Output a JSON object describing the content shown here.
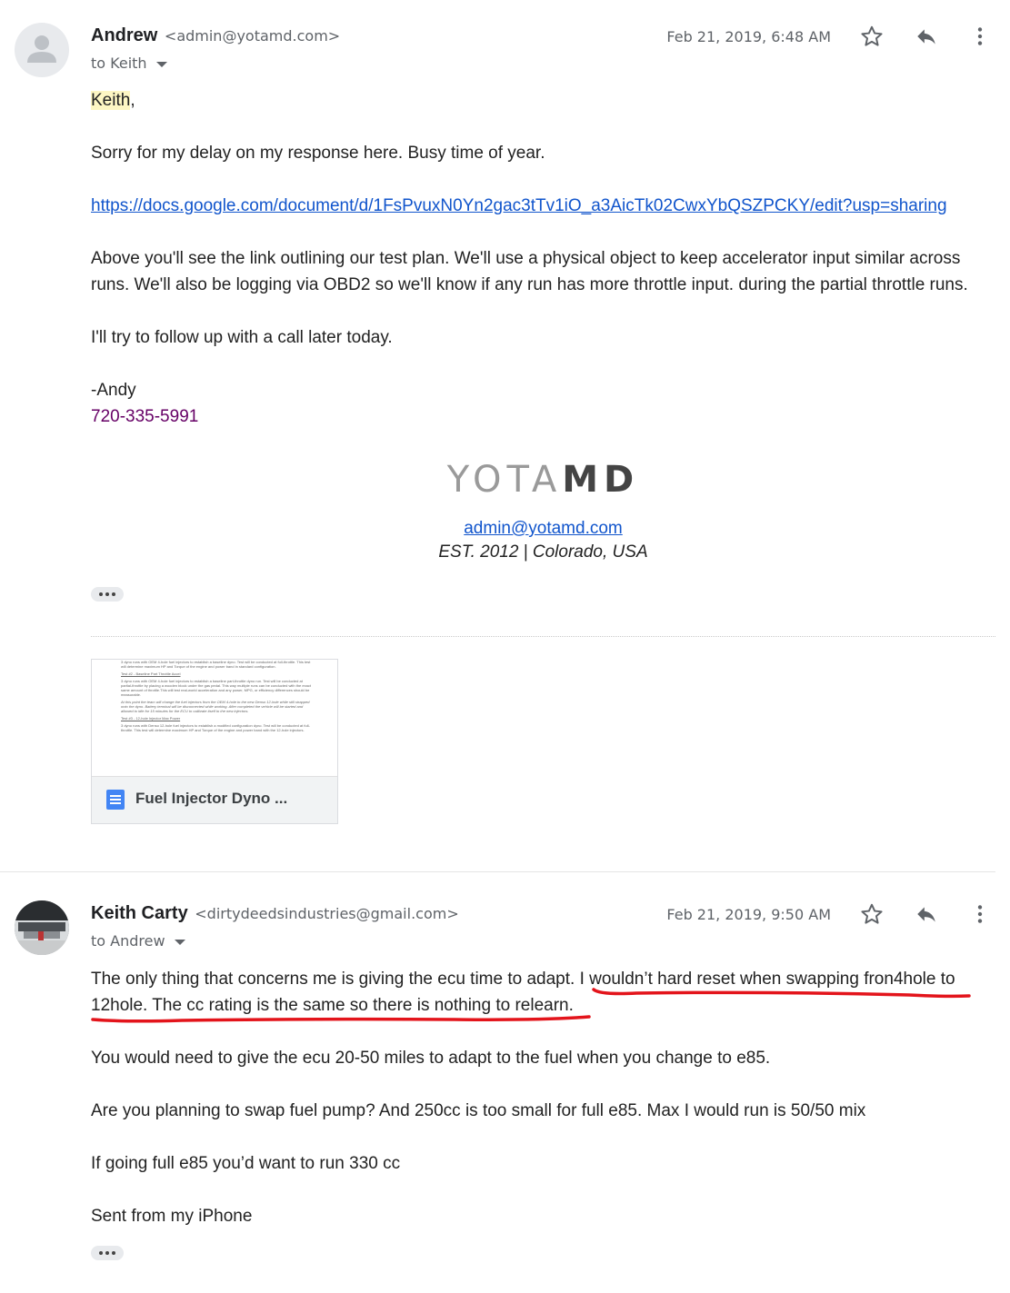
{
  "message1": {
    "sender_name": "Andrew",
    "sender_email": "<admin@yotamd.com>",
    "to": "to Keith",
    "date": "Feb 21, 2019, 6:48 AM",
    "greeting_name": "Keith",
    "greeting_punct": ",",
    "p1": "Sorry for my delay on my response here. Busy time of year.",
    "link": "https://docs.google.com/document/d/1FsPvuxN0Yn2gac3tTv1iO_a3AicTk02CwxYbQSZPCKY/edit?usp=sharing",
    "p2_line1": "Above you'll see the link outlining our test plan. We'll use a physical object to keep accelerator input similar across",
    "p2_line2": "runs. We'll also be logging via OBD2 so we'll know if any run has more throttle input. during the partial throttle runs.",
    "p3": "I'll try to follow up with a call later today.",
    "signoff": "-Andy",
    "phone": "720-335-5991",
    "signature": {
      "logo_light": "YOTA",
      "logo_bold": "MD",
      "email": "admin@yotamd.com",
      "est": "EST. 2012 | Colorado, USA"
    },
    "attachment": {
      "name": "Fuel Injector Dyno ...",
      "preview_lines": [
        "3 dyno runs with OEM 4-hole fuel injectors to establish a baseline dyno. Test will be conducted at full-throttle. This test will determine maximum HP and Torque of the engine and power band in standard configuration.",
        "Test #2 - Baseline Part Throttle Accel",
        "3 dyno runs with OEM 4-hole fuel injectors to establish a baseline part-throttle dyno run. Test will be conducted at partial-throttle by placing a wooden block under the gas pedal. This way multiple runs can be conducted with the exact same amount of throttle.This will test real-world acceleration and any power, MPG, or efficiency differences should be measurable.",
        "At this point the team will change the fuel injectors from the OEM 4-hole to the new Denso 12-hole while still strapped onto the dyno. Battery terminal will be disconnected while working. After completed the vehicle will be started and allowed to idle for 15 minutes for the ECU to calibrate itself to the new injectors.",
        "Test #3 - 12-hole Injector Max Power",
        "3 dyno runs with Denso 12-hole fuel injectors to establish a modified configuration dyno. Test will be conducted at full-throttle. This test will determine maximum HP and Torque of the engine and power band with the 12-hole injectors."
      ]
    }
  },
  "message2": {
    "sender_name": "Keith Carty",
    "sender_email": "<dirtydeedsindustries@gmail.com>",
    "to": "to Andrew",
    "date": "Feb 21, 2019, 9:50 AM",
    "p1_plain": "The only thing that concerns me is giving the ecu time to adapt. ",
    "p1_underlined_1": "I wouldn’t hard reset when swapping fron4hole to",
    "p1_underlined_2": "12hole. The cc rating is the same so there is nothing to relearn.",
    "p2": "You would need to give the ecu 20-50 miles to adapt to the fuel when you change to e85.",
    "p3": "Are you planning to swap fuel pump? And 250cc is too small for full e85. Max I would run is 50/50 mix",
    "p4": "If going full e85 you’d want to run 330 cc",
    "p5": "Sent from my iPhone"
  },
  "colors": {
    "accent_red": "#e3141b",
    "link_blue": "#1155cc",
    "doc_blue": "#4285f4"
  },
  "icons": [
    "avatar-icon",
    "star-icon",
    "reply-icon",
    "more-vert-icon",
    "ellipsis-icon",
    "google-docs-icon"
  ]
}
